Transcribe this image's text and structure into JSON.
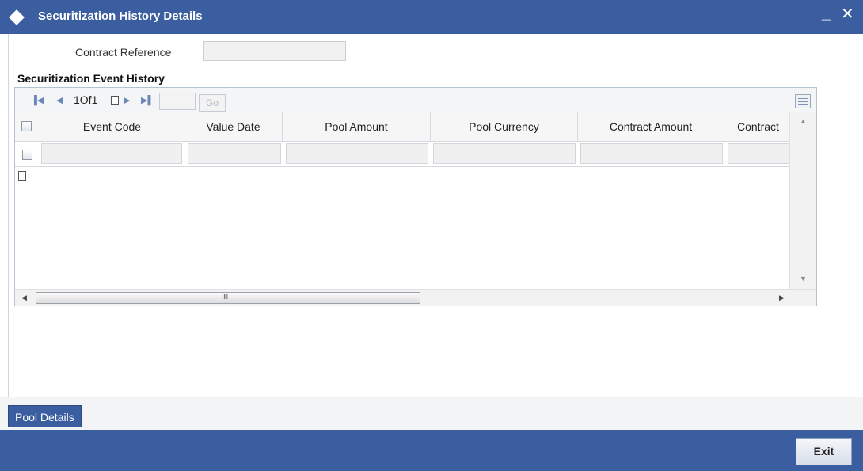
{
  "window": {
    "title": "Securitization History Details",
    "minimize_glyph": "_",
    "close_glyph": "✕"
  },
  "form": {
    "contract_reference_label": "Contract Reference",
    "contract_reference_value": ""
  },
  "section": {
    "title": "Securitization Event History"
  },
  "pager": {
    "first_icon": "first-page-icon",
    "prev_icon": "prev-page-icon",
    "page_text": "1Of1",
    "next_icon": "next-page-icon",
    "last_icon": "last-page-icon",
    "page_input_value": "",
    "go_label": "Go"
  },
  "table": {
    "columns": [
      "Event Code",
      "Value Date",
      "Pool Amount",
      "Pool Currency",
      "Contract Amount",
      "Contract"
    ],
    "rows": [
      [
        "",
        "",
        "",
        "",
        "",
        ""
      ]
    ]
  },
  "scrollbar": {
    "grip": "III"
  },
  "buttons": {
    "pool_details": "Pool Details",
    "exit": "Exit"
  },
  "colors": {
    "brand_blue": "#3b5ea0"
  }
}
